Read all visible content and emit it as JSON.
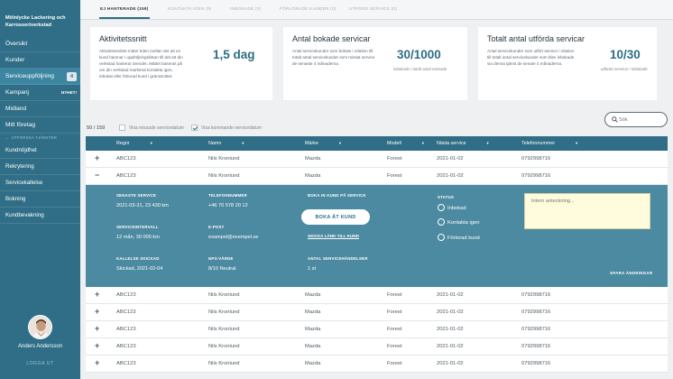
{
  "sidebar": {
    "brand_line1": "Mölnlycke Lackering och",
    "brand_line2": "Karrosseriverkstad",
    "items": [
      {
        "label": "Översikt"
      },
      {
        "label": "Kunder"
      },
      {
        "label": "Serviceuppföljning",
        "badge": "4"
      },
      {
        "label": "Kampanj",
        "tag": "NYHET!"
      },
      {
        "label": "Midland"
      },
      {
        "label": "Mitt företag"
      }
    ],
    "section_label": "UTFÖRSKA TJÄNSTER",
    "sub_items": [
      {
        "label": "Kundnöjdhet"
      },
      {
        "label": "Rekrytering"
      },
      {
        "label": "Servicekallelse"
      },
      {
        "label": "Bokning"
      },
      {
        "label": "Kundbevakning"
      }
    ],
    "user_name": "Anders Andersson",
    "logout": "LOGGA UT"
  },
  "tabs": [
    {
      "label": "EJ HANTERADE  (159)"
    },
    {
      "label": "KONTAKTA IGEN (0)"
    },
    {
      "label": "INBOKADE (0)"
    },
    {
      "label": "FÖRLORADE KUNDER (0)"
    },
    {
      "label": "UTFÖRD SERVICE (0)"
    }
  ],
  "cards": [
    {
      "title": "Aktivitetssnitt",
      "lines": [
        "Aktivitetssnittet mäter tiden mellan det att en",
        "kund hamnar i uppföljningslistan till det att din",
        "verkstad hanterar ärendet. Mättet baseras på",
        "om din verkstad markerat kontakta igen,",
        "inbokat eller förlorad kund i gränssnittet."
      ],
      "value": "1,5 dag",
      "caption": ""
    },
    {
      "title": "Antal bokade servicar",
      "lines": [
        "Antal servicekunder som bokats i relation till",
        "totalt antal servicekunder som missat service",
        "de senaste 4 månaderna."
      ],
      "value": "30/1000",
      "caption": "inbokade / totalt antal missade"
    },
    {
      "title": "Totalt antal utförda servicar",
      "lines": [
        "Antal servicekunder som utfört service i relation",
        "till totalt antal servicekunder som blev inbokade",
        "via denna tjänst de senate 4 månaderna."
      ],
      "value": "10/30",
      "caption": "utförda servicar / inbokade"
    }
  ],
  "search": {
    "placeholder": "Sök"
  },
  "list_count": "50 / 159",
  "filters": {
    "missed": "Visa missade servicedatum",
    "upcoming": "Visa kommande servicedatum"
  },
  "columns": [
    "Regnr",
    "Namn",
    "Märke",
    "Modell",
    "Nästa service",
    "Telefonnummer"
  ],
  "rows": [
    {
      "regnr": "ABC123",
      "name": "Nils Kronlund",
      "brand": "Mazda",
      "model": "Forest",
      "next": "2021-01-02",
      "phone": "0792998716",
      "toggle": "+"
    },
    {
      "regnr": "ABC123",
      "name": "Nils Kronlund",
      "brand": "Mazda",
      "model": "Forest",
      "next": "2021-01-02",
      "phone": "0792998716",
      "toggle": "−"
    },
    {
      "regnr": "ABC123",
      "name": "Nils Kronlund",
      "brand": "Mazda",
      "model": "Forest",
      "next": "2021-01-02",
      "phone": "0792998716",
      "toggle": "+"
    },
    {
      "regnr": "ABC123",
      "name": "Nils Kronlund",
      "brand": "Mazda",
      "model": "Forest",
      "next": "2021-01-02",
      "phone": "0792998716",
      "toggle": "+"
    },
    {
      "regnr": "ABC123",
      "name": "Nils Kronlund",
      "brand": "Mazda",
      "model": "Forest",
      "next": "2021-01-02",
      "phone": "0792998716",
      "toggle": "+"
    },
    {
      "regnr": "ABC123",
      "name": "Nils Kronlund",
      "brand": "Mazda",
      "model": "Forest",
      "next": "2021-01-02",
      "phone": "0792998716",
      "toggle": "+"
    },
    {
      "regnr": "ABC123",
      "name": "Nils Kronlund",
      "brand": "Mazda",
      "model": "Forest",
      "next": "2021-01-02",
      "phone": "0792998716",
      "toggle": "+"
    }
  ],
  "detail": {
    "last_service_label": "SENASTE SERVICE",
    "last_service": "2021-03-31, 23 430 km",
    "interval_label": "SERVICEINTERVALL",
    "interval": "12 mån, 30 000 km",
    "notice_label": "KALLELSE SKICKAD",
    "notice": "Skickad, 2021-02-04",
    "phone_label": "TELEFONNUMMER",
    "phone": "+46 70 578 20 12",
    "email_label": "E-POST",
    "email": "exampel@exempel.se",
    "nps_label": "NPS-VÄRDE",
    "nps": "8/10 Neutral",
    "book_label": "BOKA IN KUND PÅ SERVICE",
    "book_button": "BOKA ÅT KUND",
    "send_link": "SKICKA LÄNK TILL KUND",
    "events_label": "ANTAL SERVICEHÄNDELSER",
    "events": "1 st",
    "status_label": "STATUS",
    "status_options": [
      "Inbokad",
      "Kontakta igen",
      "Förlorad kund"
    ],
    "note_placeholder": "Intern anteckning...",
    "save": "SPARA ÄNDRINGAR"
  },
  "colors": {
    "accent": "#2f6e86",
    "panel": "#4c8aa1",
    "note": "#fffbdd"
  }
}
